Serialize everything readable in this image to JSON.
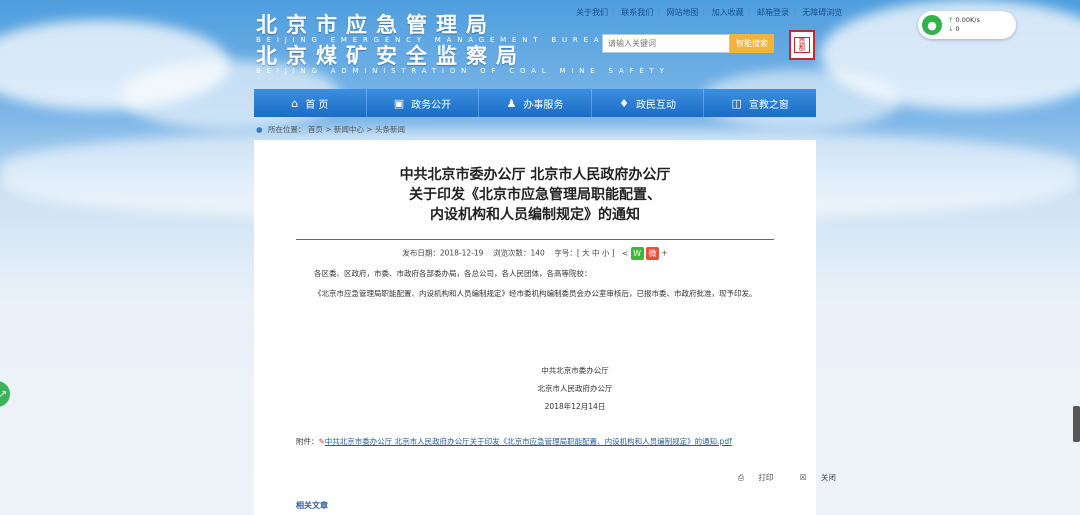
{
  "header": {
    "logo_line1_cn": "北京市应急管理局",
    "logo_line1_en": "BEIJING EMERGENCY MANAGEMENT BUREAU",
    "logo_line2_cn": "北京煤矿安全监察局",
    "logo_line2_en": "BEIJING ADMINISTRATION OF COAL MINE SAFETY",
    "top_links": [
      "关于我们",
      "联系我们",
      "网站地图",
      "加入收藏",
      "邮箱登录",
      "无障碍浏览"
    ],
    "search_placeholder": "请输入关键词",
    "search_button": "智能搜索",
    "seal_text": "首都之窗"
  },
  "net_widget": {
    "upload": "0.00K/s",
    "download": "0"
  },
  "nav": {
    "items": [
      {
        "label": "首    页",
        "icon": "home-icon"
      },
      {
        "label": "政务公开",
        "icon": "monitor-icon"
      },
      {
        "label": "办事服务",
        "icon": "person-icon"
      },
      {
        "label": "政民互动",
        "icon": "handshake-icon"
      },
      {
        "label": "宣教之窗",
        "icon": "screen-icon"
      }
    ]
  },
  "breadcrumb": {
    "prefix": "所在位置：",
    "items": [
      "首页",
      "新闻中心",
      "头条新闻"
    ]
  },
  "article": {
    "title_line1": "中共北京市委办公厅 北京市人民政府办公厅",
    "title_line2": "关于印发《北京市应急管理局职能配置、",
    "title_line3": "内设机构和人员编制规定》的通知",
    "publish_label": "发布日期：",
    "publish_date": "2018-12-19",
    "views_label": "浏览次数：",
    "views": "140",
    "font_label": "字号：[ 大 中 小 ]",
    "salutation": "各区委、区政府，市委、市政府各部委办局，各总公司，各人民团体，各高等院校：",
    "paragraph": "《北京市应急管理局职能配置、内设机构和人员编制规定》经市委机构编制委员会办公室审核后，已报市委、市政府批准，现予印发。",
    "signer1": "中共北京市委办公厅",
    "signer2": "北京市人民政府办公厅",
    "sign_date": "2018年12月14日",
    "attachment_label": "附件：",
    "attachment_name": "中共北京市委办公厅 北京市人民政府办公厅关于印发《北京市应急管理局职能配置、内设机构和人员编制规定》的通知.pdf",
    "print_label": "打印",
    "close_label": "关闭",
    "related_label": "相关文章"
  },
  "colors": {
    "nav_bg": "#1b6cc4",
    "search_button": "#f2b33b",
    "link": "#2a5d9f",
    "seal_red": "#c8262a"
  }
}
